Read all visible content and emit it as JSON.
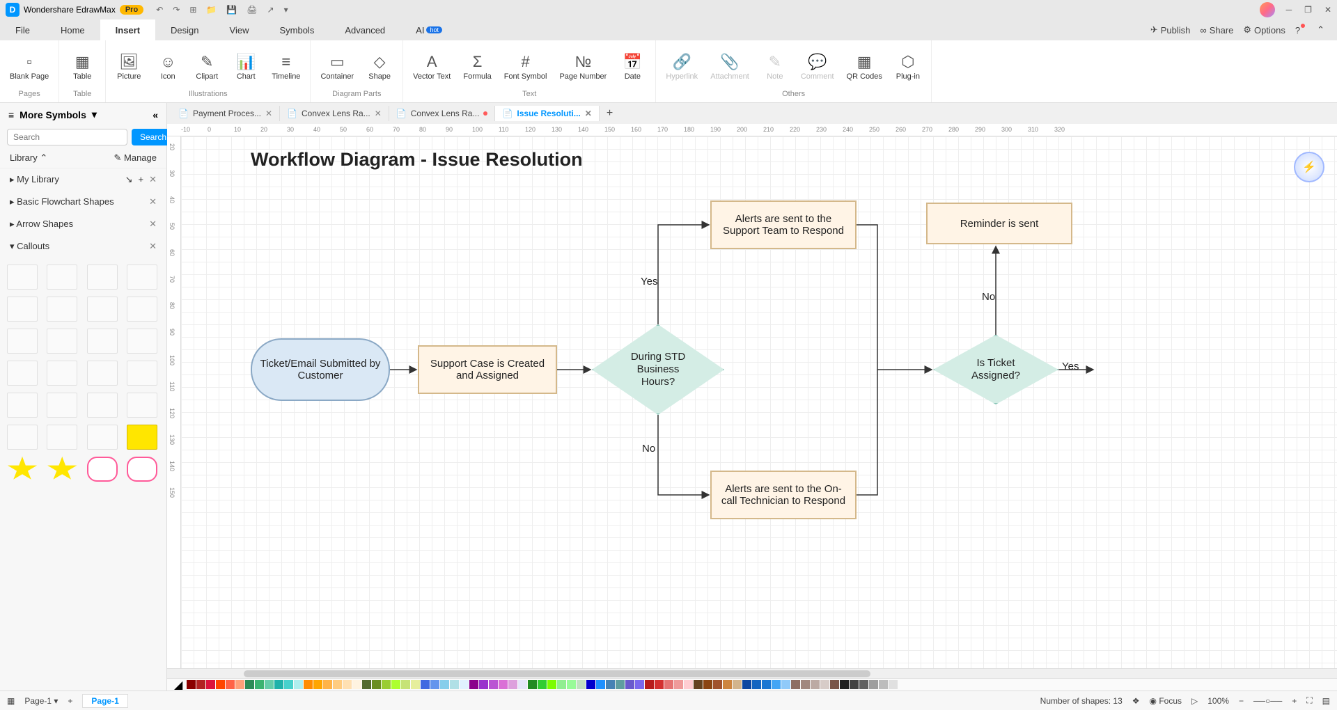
{
  "app": {
    "name": "Wondershare EdrawMax",
    "badge": "Pro"
  },
  "window_controls": {
    "min": "─",
    "max": "❐",
    "close": "✕"
  },
  "menu": {
    "tabs": [
      "File",
      "Home",
      "Insert",
      "Design",
      "View",
      "Symbols",
      "Advanced",
      "AI"
    ],
    "active": "Insert",
    "hot": "hot",
    "right": {
      "publish": "Publish",
      "share": "Share",
      "options": "Options"
    }
  },
  "ribbon": {
    "groups": [
      {
        "label": "Pages",
        "items": [
          {
            "name": "Blank Page"
          }
        ]
      },
      {
        "label": "Table",
        "items": [
          {
            "name": "Table"
          }
        ]
      },
      {
        "label": "Illustrations",
        "items": [
          {
            "name": "Picture"
          },
          {
            "name": "Icon"
          },
          {
            "name": "Clipart"
          },
          {
            "name": "Chart"
          },
          {
            "name": "Timeline"
          }
        ]
      },
      {
        "label": "Diagram Parts",
        "items": [
          {
            "name": "Container"
          },
          {
            "name": "Shape"
          }
        ]
      },
      {
        "label": "Text",
        "items": [
          {
            "name": "Vector Text"
          },
          {
            "name": "Formula"
          },
          {
            "name": "Font Symbol"
          },
          {
            "name": "Page Number"
          },
          {
            "name": "Date"
          }
        ]
      },
      {
        "label": "Others",
        "items": [
          {
            "name": "Hyperlink",
            "disabled": true
          },
          {
            "name": "Attachment",
            "disabled": true
          },
          {
            "name": "Note",
            "disabled": true
          },
          {
            "name": "Comment",
            "disabled": true
          },
          {
            "name": "QR Codes"
          },
          {
            "name": "Plug-in"
          }
        ]
      }
    ]
  },
  "sidebar": {
    "title": "More Symbols",
    "search_placeholder": "Search",
    "search_btn": "Search",
    "library": "Library",
    "manage": "Manage",
    "categories": [
      {
        "name": "My Library"
      },
      {
        "name": "Basic Flowchart Shapes"
      },
      {
        "name": "Arrow Shapes"
      },
      {
        "name": "Callouts",
        "expanded": true
      }
    ]
  },
  "doc_tabs": [
    {
      "label": "Payment Proces...",
      "active": false
    },
    {
      "label": "Convex Lens Ra...",
      "active": false
    },
    {
      "label": "Convex Lens Ra...",
      "active": false,
      "modified": true
    },
    {
      "label": "Issue Resoluti...",
      "active": true
    }
  ],
  "canvas": {
    "title": "Workflow Diagram - Issue Resolution",
    "nodes": {
      "start": "Ticket/Email Submitted by Customer",
      "proc1": "Support Case is Created and Assigned",
      "dec1": "During STD Business Hours?",
      "alert1": "Alerts are sent to the Support Team to Respond",
      "alert2": "Alerts are sent to the On-call Technician to Respond",
      "remind": "Reminder is sent",
      "dec2": "Is Ticket Assigned?"
    },
    "labels": {
      "yes": "Yes",
      "no": "No"
    }
  },
  "ruler_h": [
    -10,
    0,
    10,
    20,
    30,
    40,
    50,
    60,
    70,
    80,
    90,
    100,
    110,
    120,
    130,
    140,
    150,
    160,
    170,
    180,
    190,
    200,
    210,
    220,
    230,
    240,
    250,
    260,
    270,
    280,
    290,
    300,
    310,
    320
  ],
  "ruler_v": [
    20,
    30,
    40,
    50,
    60,
    70,
    80,
    90,
    100,
    110,
    120,
    130,
    140,
    150
  ],
  "colors": [
    "#8b0000",
    "#b22222",
    "#dc143c",
    "#ff4500",
    "#ff6347",
    "#ffa07a",
    "#2e8b57",
    "#3cb371",
    "#66cdaa",
    "#20b2aa",
    "#48d1cc",
    "#afeeee",
    "#ff8c00",
    "#ffa500",
    "#ffb347",
    "#ffcc80",
    "#ffe0b2",
    "#fff3e0",
    "#556b2f",
    "#6b8e23",
    "#9acd32",
    "#adff2f",
    "#c6e377",
    "#e6ee9c",
    "#4169e1",
    "#6495ed",
    "#87ceeb",
    "#b0e0e6",
    "#e0f2ff",
    "#8b008b",
    "#9932cc",
    "#ba55d3",
    "#da70d6",
    "#dda0dd",
    "#e6e6fa",
    "#228b22",
    "#32cd32",
    "#7cfc00",
    "#90ee90",
    "#98fb98",
    "#c1e1c1",
    "#0000cd",
    "#1e90ff",
    "#4682b4",
    "#5f9ea0",
    "#6a5acd",
    "#7b68ee",
    "#b71c1c",
    "#d32f2f",
    "#e57373",
    "#ef9a9a",
    "#ffcdd2",
    "#654321",
    "#8b4513",
    "#a0522d",
    "#cd853f",
    "#d2b48c",
    "#0d47a1",
    "#1565c0",
    "#1976d2",
    "#42a5f5",
    "#90caf9",
    "#8d6e63",
    "#a1887f",
    "#bcaaa4",
    "#d7ccc8",
    "#795548",
    "#212121",
    "#424242",
    "#616161",
    "#9e9e9e",
    "#bdbdbd",
    "#e0e0e0"
  ],
  "status": {
    "page": "Page-1",
    "page_tab": "Page-1",
    "shapes": "Number of shapes: 13",
    "focus": "Focus",
    "zoom": "100%"
  }
}
